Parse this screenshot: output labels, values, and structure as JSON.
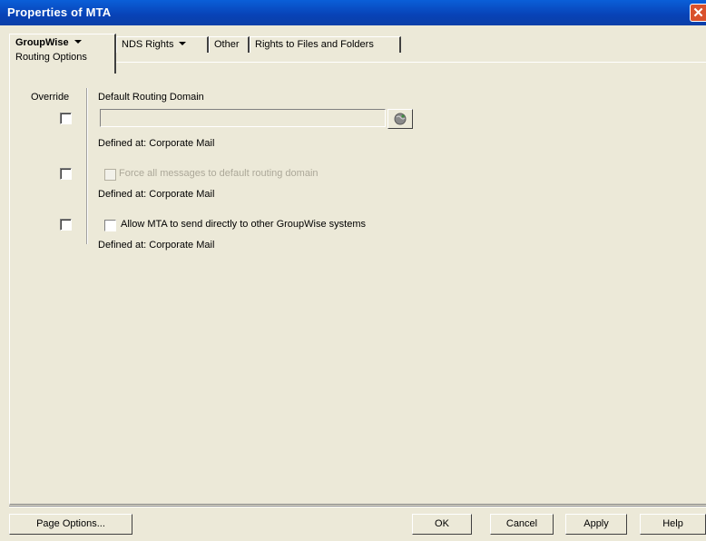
{
  "window": {
    "title": "Properties of MTA",
    "close_glyph": "✕"
  },
  "tabs": [
    {
      "label": "GroupWise",
      "dropdown": true,
      "active": true,
      "subtab": "Routing Options"
    },
    {
      "label": "NDS Rights",
      "dropdown": true
    },
    {
      "label": "Other",
      "dropdown": false
    },
    {
      "label": "Rights to Files and Folders",
      "dropdown": false
    }
  ],
  "form": {
    "override_label": "Override",
    "default_routing_domain": {
      "label": "Default Routing Domain",
      "value": "",
      "defined_at": "Defined at: Corporate Mail",
      "browse_icon": "browse-globe-icon"
    },
    "force_messages": {
      "label": "Force all messages to default routing domain",
      "checked": false,
      "enabled": false,
      "defined_at": "Defined at: Corporate Mail"
    },
    "allow_mta": {
      "label": "Allow MTA to send directly to other GroupWise systems",
      "checked": false,
      "enabled": true,
      "defined_at": "Defined at: Corporate Mail"
    }
  },
  "footer": {
    "page_options": "Page Options...",
    "ok": "OK",
    "cancel": "Cancel",
    "apply": "Apply",
    "help": "Help"
  },
  "colors": {
    "titlebar": "#0842b6",
    "close": "#d9512c",
    "dialog_bg": "#ece9d8"
  }
}
